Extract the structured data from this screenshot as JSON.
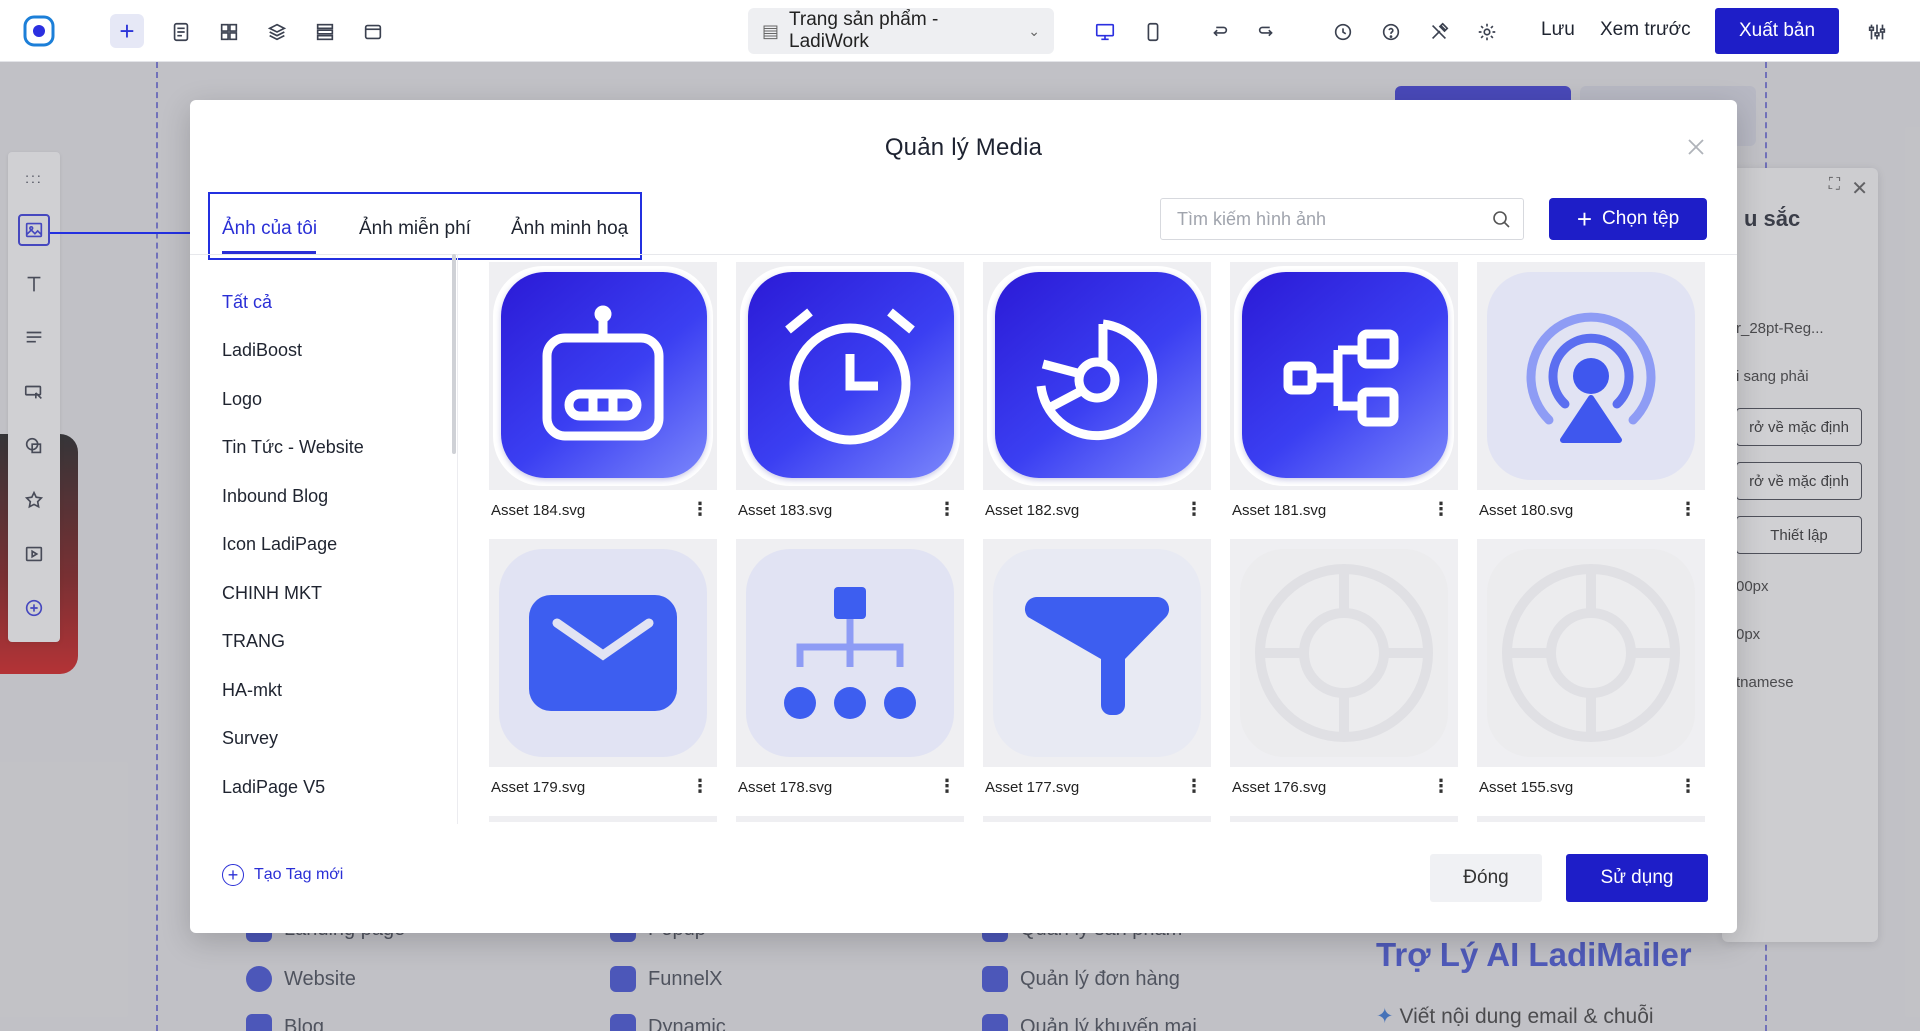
{
  "topbar": {
    "page_selector": "Trang sản phẩm - LadiWork",
    "save_label": "Lưu",
    "preview_label": "Xem trước",
    "publish_label": "Xuất bản"
  },
  "background": {
    "right_panel": {
      "title": "u sắc",
      "font_value": "r_28pt-Reg...",
      "direction_value": "i sang phải",
      "reset_1": "rở về mặc định",
      "reset_2": "rở về mặc định",
      "setup": "Thiết lập",
      "size_1": "00px",
      "size_2": "0px",
      "language": "tnamese"
    },
    "bottom_items": [
      "Website",
      "FunnelX",
      "Quản lý đơn hàng",
      "Blog",
      "Dynamic",
      "Quản lý khuyến mại",
      "Landing page",
      "Popup",
      "Quản lý sản phẩm"
    ],
    "ai_title": "Trợ Lý AI LadiMailer",
    "ai_sub": "Viết nội dung email & chuỗi"
  },
  "modal": {
    "title": "Quản lý Media",
    "tabs": [
      {
        "label": "Ảnh của tôi",
        "active": true
      },
      {
        "label": "Ảnh miễn phí",
        "active": false
      },
      {
        "label": "Ảnh minh hoạ",
        "active": false
      }
    ],
    "search_placeholder": "Tìm kiếm hình ảnh",
    "choose_file_label": "Chọn tệp",
    "categories": [
      "Tất cả",
      "LadiBoost",
      "Logo",
      "Tin Tức - Website",
      "Inbound Blog",
      "Icon LadiPage",
      "CHINH MKT",
      "TRANG",
      "HA-mkt",
      "Survey",
      "LadiPage V5"
    ],
    "new_tag_label": "Tạo Tag mới",
    "assets": [
      {
        "name": "Asset 184.svg",
        "icon": "robot-icon"
      },
      {
        "name": "Asset 183.svg",
        "icon": "alarm-clock-icon"
      },
      {
        "name": "Asset 182.svg",
        "icon": "pie-chart-icon"
      },
      {
        "name": "Asset 181.svg",
        "icon": "hierarchy-icon"
      },
      {
        "name": "Asset 180.svg",
        "icon": "broadcast-user-icon"
      },
      {
        "name": "Asset 179.svg",
        "icon": "mail-icon"
      },
      {
        "name": "Asset 178.svg",
        "icon": "org-chart-icon"
      },
      {
        "name": "Asset 177.svg",
        "icon": "funnel-icon"
      },
      {
        "name": "Asset 176.svg",
        "icon": "ring-placeholder-icon"
      },
      {
        "name": "Asset 155.svg",
        "icon": "ring-placeholder-icon"
      }
    ],
    "close_label": "Đóng",
    "use_label": "Sử dụng"
  },
  "colors": {
    "accent": "#1e1ec8",
    "link": "#2a2fd6"
  }
}
